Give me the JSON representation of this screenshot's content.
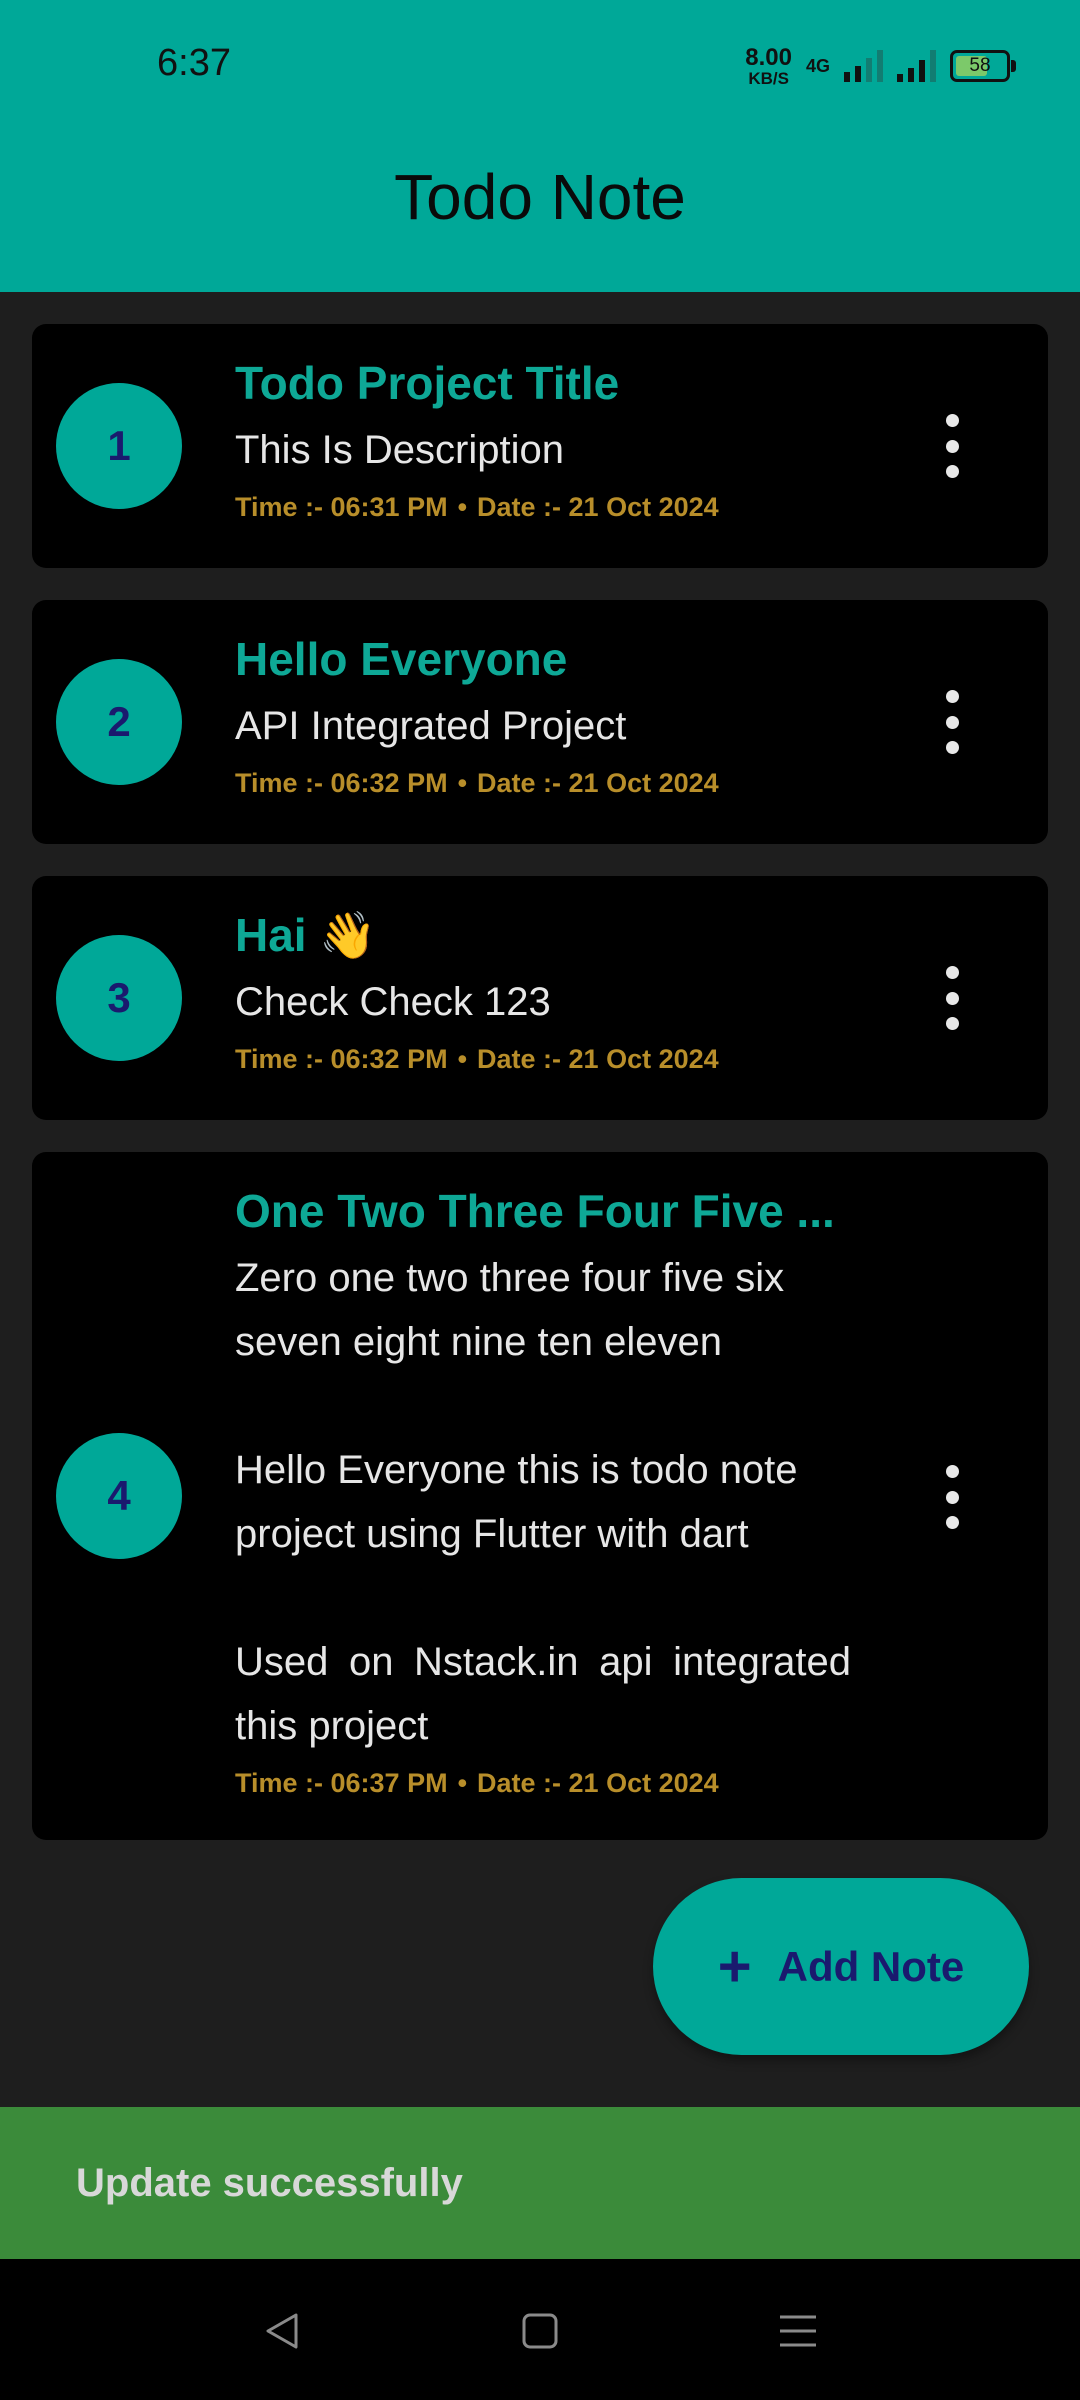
{
  "status_bar": {
    "time": "6:37",
    "speed_value": "8.00",
    "speed_unit": "KB/S",
    "network": "4G",
    "battery": "58"
  },
  "app_bar": {
    "title": "Todo Note"
  },
  "notes": [
    {
      "number": "1",
      "title": "Todo Project Title",
      "description": "This Is Description",
      "time": "Time :- 06:31 PM",
      "date": "Date :- 21 Oct 2024"
    },
    {
      "number": "2",
      "title": "Hello Everyone",
      "description": "API Integrated Project",
      "time": "Time :- 06:32 PM",
      "date": "Date :- 21 Oct 2024"
    },
    {
      "number": "3",
      "title": "Hai 👋",
      "description": "Check Check 123",
      "time": "Time :- 06:32 PM",
      "date": "Date :- 21 Oct 2024"
    },
    {
      "number": "4",
      "title": "One Two Three Four Five ...",
      "description_lines": [
        "Zero one two three four five six seven eight nine ten eleven",
        "Hello Everyone this is todo note project using Flutter with dart",
        "Used on Nstack.in api integrated this project"
      ],
      "time": "Time :- 06:37 PM",
      "date": "Date :- 21 Oct 2024"
    }
  ],
  "fab": {
    "icon": "plus-icon",
    "label": "Add Note"
  },
  "snackbar": {
    "message": "Update successfully"
  },
  "nav_bar": {
    "icons": [
      "back-icon",
      "home-icon",
      "menu-icon"
    ]
  },
  "colors": {
    "accent": "#00a898",
    "title_text": "#0ea896",
    "meta_text": "#b88e2a",
    "snackbar_bg": "#3b8b3a",
    "card_bg": "#000000",
    "page_bg": "#1e1e1e"
  }
}
